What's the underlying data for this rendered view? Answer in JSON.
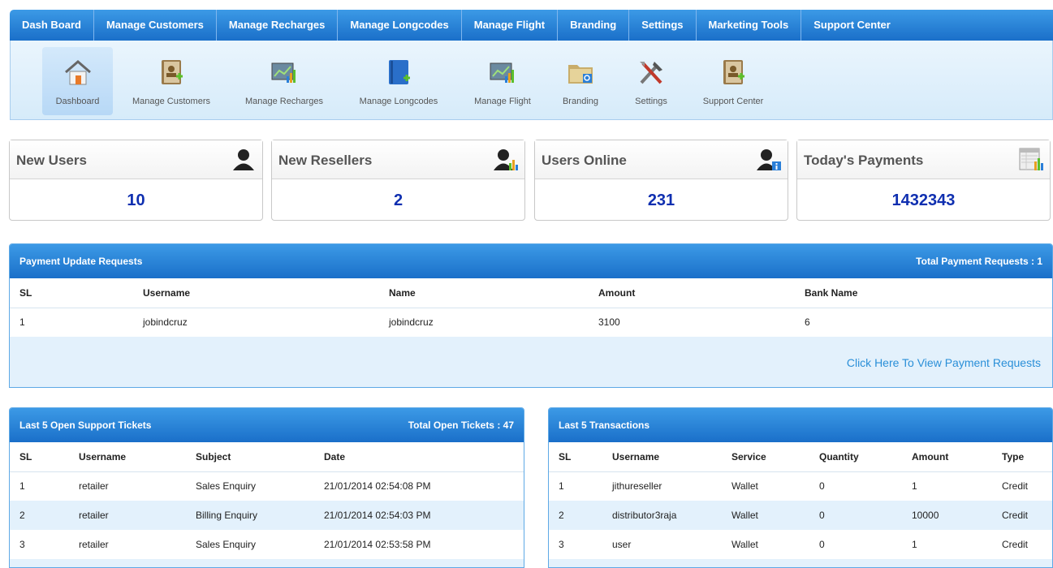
{
  "topnav": [
    "Dash Board",
    "Manage Customers",
    "Manage Recharges",
    "Manage Longcodes",
    "Manage Flight",
    "Branding",
    "Settings",
    "Marketing Tools",
    "Support Center"
  ],
  "iconbar": [
    {
      "label": "Dashboard",
      "icon": "house-icon",
      "active": true
    },
    {
      "label": "Manage Customers",
      "icon": "address-book-icon"
    },
    {
      "label": "Manage Recharges",
      "icon": "chart-icon"
    },
    {
      "label": "Manage Longcodes",
      "icon": "book-icon"
    },
    {
      "label": "Manage Flight",
      "icon": "chart-icon"
    },
    {
      "label": "Branding",
      "icon": "folder-icon"
    },
    {
      "label": "Settings",
      "icon": "tools-icon"
    },
    {
      "label": "Support Center",
      "icon": "address-book-icon"
    }
  ],
  "stats": [
    {
      "title": "New Users",
      "value": "10",
      "icon": "user-icon"
    },
    {
      "title": "New Resellers",
      "value": "2",
      "icon": "reseller-icon"
    },
    {
      "title": "Users Online",
      "value": "231",
      "icon": "user-info-icon"
    },
    {
      "title": "Today's Payments",
      "value": "1432343",
      "icon": "report-icon"
    }
  ],
  "payments": {
    "title": "Payment Update Requests",
    "total": "Total Payment Requests : 1",
    "columns": [
      "SL",
      "Username",
      "Name",
      "Amount",
      "Bank Name"
    ],
    "rows": [
      [
        "1",
        "jobindcruz",
        "jobindcruz",
        "3100",
        "6"
      ]
    ],
    "link": "Click Here To View Payment Requests"
  },
  "tickets": {
    "title": "Last 5 Open Support Tickets",
    "total": "Total Open Tickets : 47",
    "columns": [
      "SL",
      "Username",
      "Subject",
      "Date"
    ],
    "rows": [
      [
        "1",
        "retailer",
        "Sales Enquiry",
        "21/01/2014 02:54:08 PM"
      ],
      [
        "2",
        "retailer",
        "Billing Enquiry",
        "21/01/2014 02:54:03 PM"
      ],
      [
        "3",
        "retailer",
        "Sales Enquiry",
        "21/01/2014 02:53:58 PM"
      ]
    ]
  },
  "transactions": {
    "title": "Last 5 Transactions",
    "columns": [
      "SL",
      "Username",
      "Service",
      "Quantity",
      "Amount",
      "Type"
    ],
    "rows": [
      [
        "1",
        "jithureseller",
        "Wallet",
        "0",
        "1",
        "Credit"
      ],
      [
        "2",
        "distributor3raja",
        "Wallet",
        "0",
        "10000",
        "Credit"
      ],
      [
        "3",
        "user",
        "Wallet",
        "0",
        "1",
        "Credit"
      ]
    ]
  }
}
